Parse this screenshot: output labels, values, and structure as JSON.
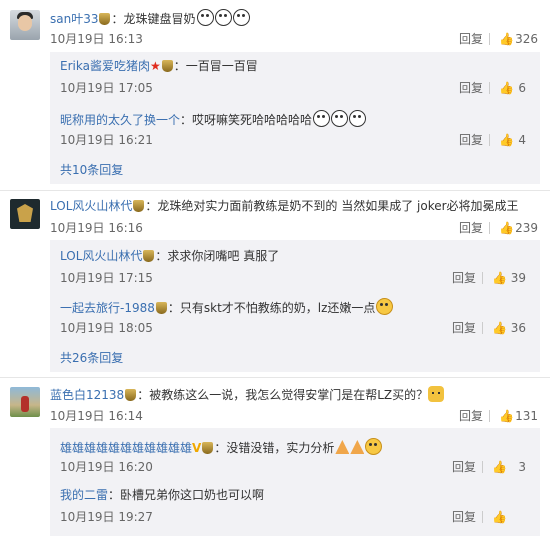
{
  "comments": [
    {
      "user": "san叶33",
      "text": "：龙珠键盘冒奶",
      "time": "10月19日 16:13",
      "reply_label": "回复",
      "likes": "326",
      "replies": [
        {
          "user": "Erika酱爱吃猪肉",
          "text": "：一百冒一百冒",
          "time": "10月19日 17:05",
          "reply_label": "回复",
          "likes": "6"
        },
        {
          "user": "昵称用的太久了换一个",
          "text": "：哎呀嘛笑死哈哈哈哈哈",
          "time": "10月19日 16:21",
          "reply_label": "回复",
          "likes": "4"
        }
      ],
      "more": "共10条回复"
    },
    {
      "user": "LOL风火山林代",
      "text": "：龙珠绝对实力面前教练是奶不到的 当然如果成了 joker必将加冕成王",
      "time": "10月19日 16:16",
      "reply_label": "回复",
      "likes": "239",
      "replies": [
        {
          "user": "LOL风火山林代",
          "text": "：求求你闭嘴吧 真服了",
          "time": "10月19日 17:15",
          "reply_label": "回复",
          "likes": "39"
        },
        {
          "user": "一起去旅行-1988",
          "text": "：只有skt才不怕教练的奶，lz还嫩一点",
          "time": "10月19日 18:05",
          "reply_label": "回复",
          "likes": "36"
        }
      ],
      "more": "共26条回复"
    },
    {
      "user": "蓝色白12138",
      "text": "：被教练这么一说，我怎么觉得安掌门是在帮LZ买的？",
      "time": "10月19日 16:14",
      "reply_label": "回复",
      "likes": "131",
      "replies": [
        {
          "user": "雄雄雄雄雄雄雄雄雄雄雄",
          "text": "：没错没错，实力分析",
          "time": "10月19日 16:20",
          "reply_label": "回复",
          "likes": "3"
        },
        {
          "user": "我的二雷",
          "text": "：卧槽兄弟你这口奶也可以啊",
          "time": "10月19日 19:27",
          "reply_label": "回复",
          "likes": ""
        }
      ]
    }
  ],
  "icons": {
    "like": "thumbs-up-icon",
    "badge": "lol-badge-icon"
  },
  "colors": {
    "username": "#3a6fb0",
    "reply_bg": "#f2f2f5"
  }
}
